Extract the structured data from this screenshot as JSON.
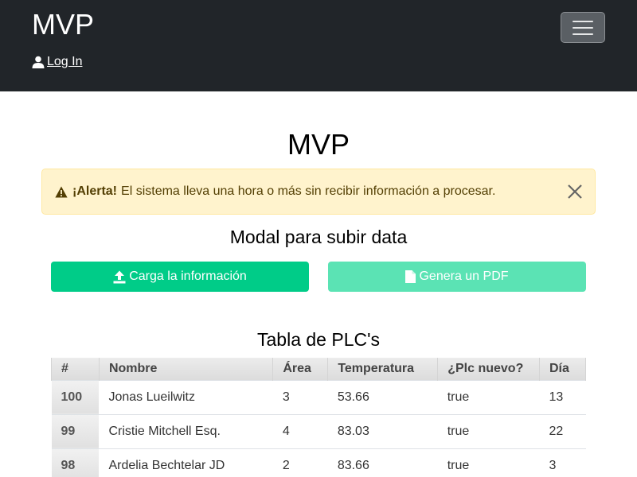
{
  "navbar": {
    "brand": "MVP",
    "login_label": "Log In",
    "login_icon": "user-icon",
    "toggler_icon": "hamburger-icon"
  },
  "page": {
    "title": "MVP"
  },
  "alert": {
    "icon": "warning-icon",
    "strong": "¡Alerta!",
    "message": "El sistema lleva una hora o más sin recibir información a procesar.",
    "close_icon": "close-icon"
  },
  "modal": {
    "title": "Modal para subir data",
    "upload_label": "Carga la información",
    "upload_icon": "upload-icon",
    "pdf_label": "Genera un PDF",
    "pdf_icon": "file-icon"
  },
  "table": {
    "title": "Tabla de PLC's",
    "headers": [
      "#",
      "Nombre",
      "Área",
      "Temperatura",
      "¿Plc nuevo?",
      "Día"
    ],
    "rows": [
      [
        "100",
        "Jonas Lueilwitz",
        "3",
        "53.66",
        "true",
        "13"
      ],
      [
        "99",
        "Cristie Mitchell Esq.",
        "4",
        "83.03",
        "true",
        "22"
      ],
      [
        "98",
        "Ardelia Bechtelar JD",
        "2",
        "83.66",
        "true",
        "3"
      ]
    ]
  },
  "colors": {
    "navbar_bg": "#212529",
    "alert_bg": "#fff3cd",
    "primary_button": "#00cc88",
    "secondary_button": "#5be3b4"
  }
}
